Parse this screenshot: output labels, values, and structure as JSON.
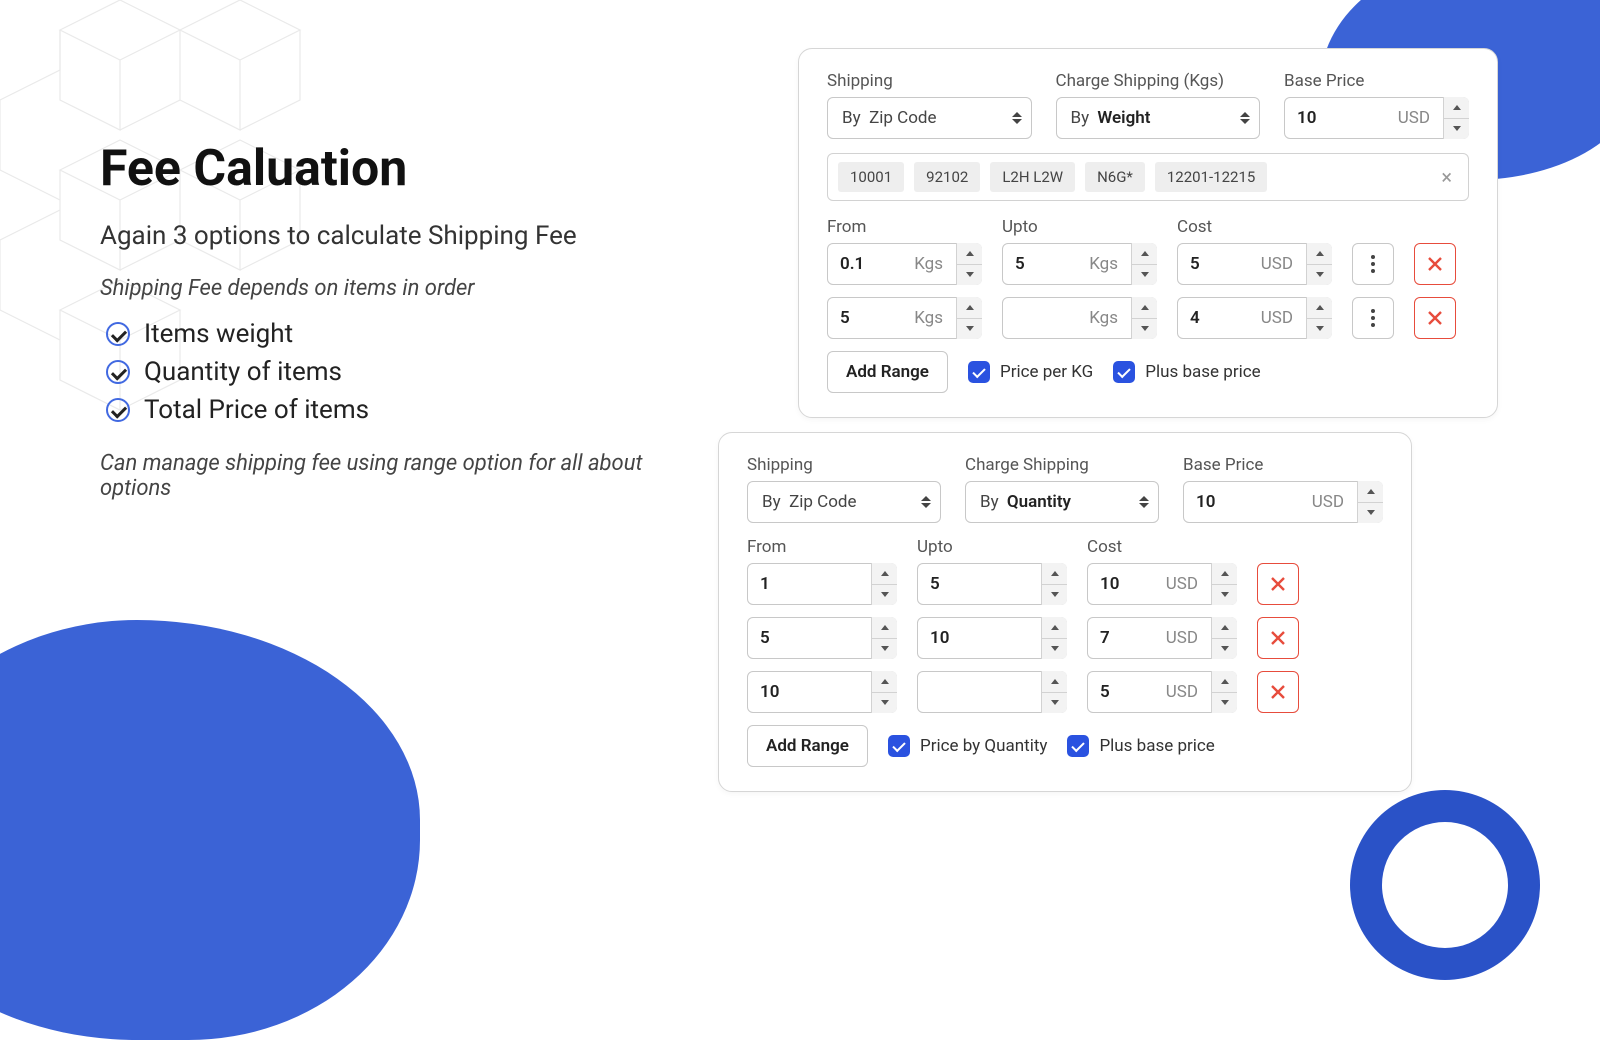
{
  "left": {
    "title": "Fee Caluation",
    "subtitle": "Again 3 options to calculate Shipping Fee",
    "note1": "Shipping Fee depends on items in order",
    "bullets": [
      "Items weight",
      "Quantity of items",
      "Total Price of items"
    ],
    "note2": "Can manage shipping fee using range option for all about options"
  },
  "panel1": {
    "shipping_label": "Shipping",
    "shipping_prefix": "By",
    "shipping_value": "Zip Code",
    "charge_label": "Charge Shipping (Kgs)",
    "charge_prefix": "By",
    "charge_value": "Weight",
    "base_label": "Base Price",
    "base_value": "10",
    "base_unit": "USD",
    "chips": [
      "10001",
      "92102",
      "L2H L2W",
      "N6G*",
      "12201-12215"
    ],
    "from_label": "From",
    "upto_label": "Upto",
    "cost_label": "Cost",
    "unit_weight": "Kgs",
    "unit_cost": "USD",
    "rows": [
      {
        "from": "0.1",
        "upto": "5",
        "cost": "5"
      },
      {
        "from": "5",
        "upto": "",
        "cost": "4"
      }
    ],
    "add_range": "Add Range",
    "cb1": "Price per KG",
    "cb2": "Plus base price"
  },
  "panel2": {
    "shipping_label": "Shipping",
    "shipping_prefix": "By",
    "shipping_value": "Zip Code",
    "charge_label": "Charge Shipping",
    "charge_prefix": "By",
    "charge_value": "Quantity",
    "base_label": "Base Price",
    "base_value": "10",
    "base_unit": "USD",
    "from_label": "From",
    "upto_label": "Upto",
    "cost_label": "Cost",
    "unit_cost": "USD",
    "rows": [
      {
        "from": "1",
        "upto": "5",
        "cost": "10"
      },
      {
        "from": "5",
        "upto": "10",
        "cost": "7"
      },
      {
        "from": "10",
        "upto": "",
        "cost": "5"
      }
    ],
    "add_range": "Add Range",
    "cb1": "Price by Quantity",
    "cb2": "Plus base price"
  }
}
